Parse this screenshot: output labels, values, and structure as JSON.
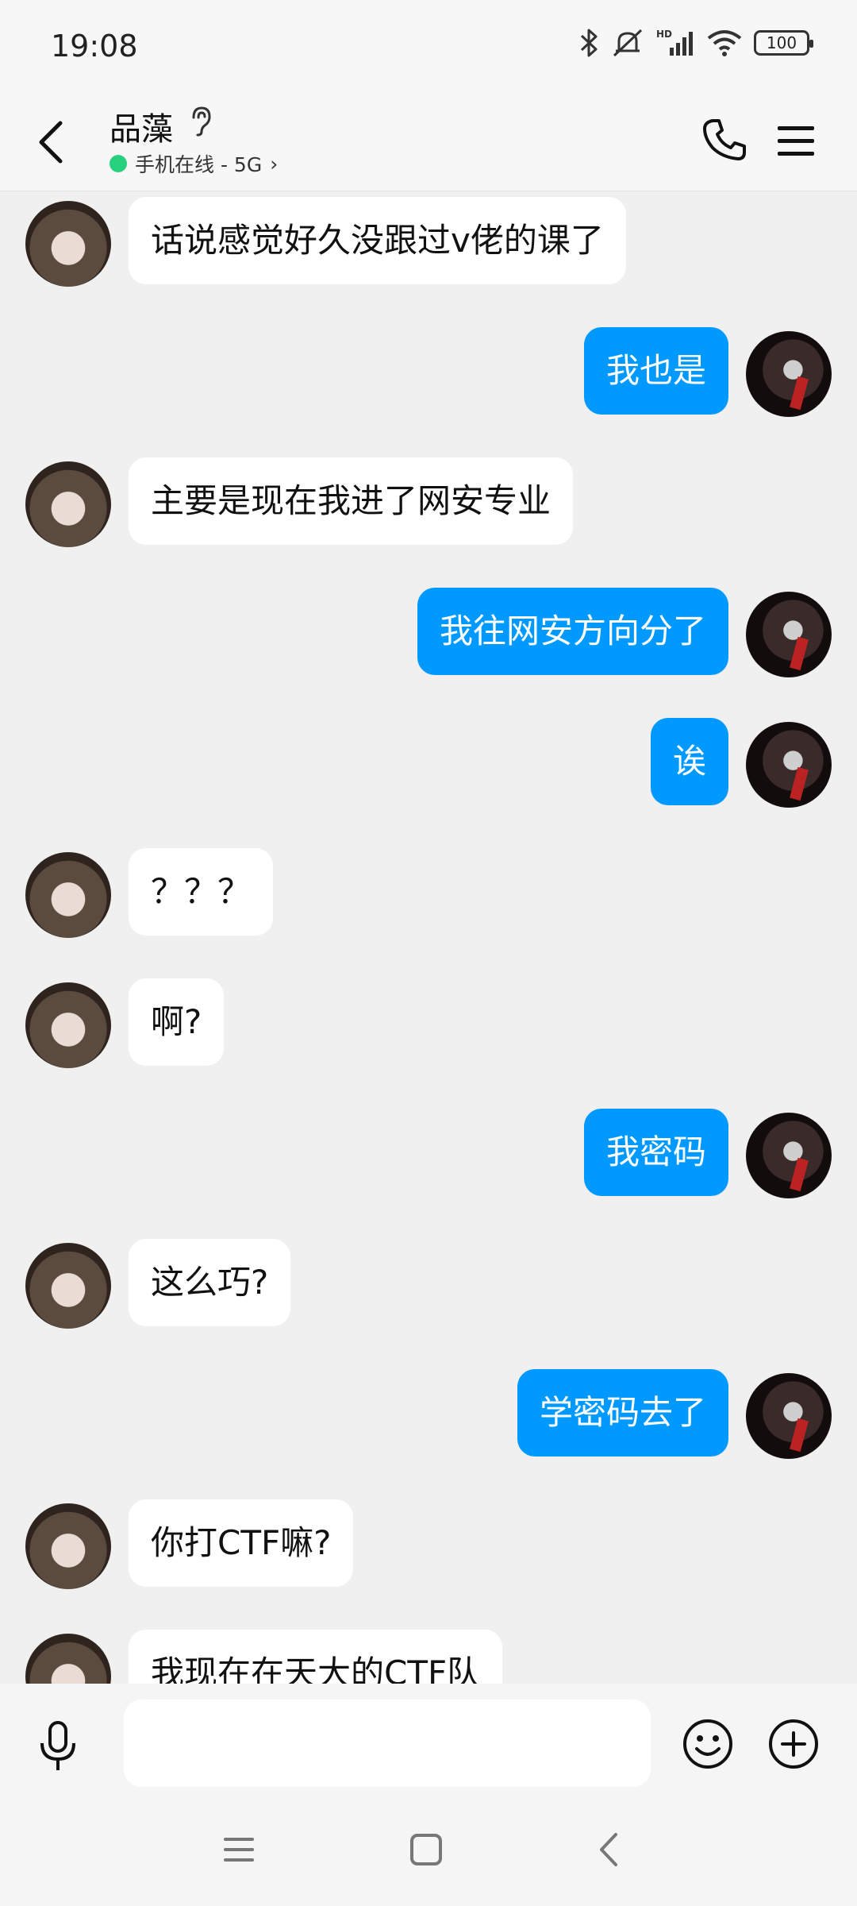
{
  "status_bar": {
    "time": "19:08",
    "battery": "100",
    "icons": [
      "bluetooth-icon",
      "mute-icon",
      "signal-hd-icon",
      "wifi-icon",
      "battery-icon"
    ]
  },
  "header": {
    "contact_name": "品藻",
    "status_text": "手机在线 - 5G",
    "status_chevron": "›",
    "online_color": "#26d07c"
  },
  "messages": [
    {
      "side": "left",
      "text": "话说感觉好久没跟过v佬的课了"
    },
    {
      "side": "right",
      "text": "我也是"
    },
    {
      "side": "left",
      "text": "主要是现在我进了网安专业"
    },
    {
      "side": "right",
      "text": "我往网安方向分了"
    },
    {
      "side": "right",
      "text": "诶"
    },
    {
      "side": "left",
      "text": "？？？"
    },
    {
      "side": "left",
      "text": "啊?"
    },
    {
      "side": "right",
      "text": "我密码"
    },
    {
      "side": "left",
      "text": "这么巧?"
    },
    {
      "side": "right",
      "text": "学密码去了"
    },
    {
      "side": "left",
      "text": "你打CTF嘛?"
    },
    {
      "side": "left",
      "text": "我现在在天大的CTF队"
    }
  ],
  "input": {
    "value": "",
    "placeholder": ""
  },
  "colors": {
    "sent_bubble": "#0099ff",
    "received_bubble": "#ffffff",
    "background": "#f0f0f0"
  }
}
